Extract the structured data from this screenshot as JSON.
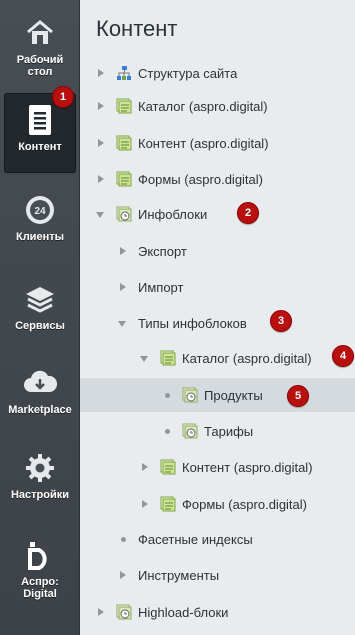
{
  "sidebar": {
    "items": [
      {
        "label": "Рабочий стол",
        "icon": "home-icon"
      },
      {
        "label": "Контент",
        "icon": "document-icon",
        "active": true
      },
      {
        "label": "Клиенты",
        "icon": "clock-24-icon"
      },
      {
        "label": "Сервисы",
        "icon": "layers-icon"
      },
      {
        "label": "Marketplace",
        "icon": "cloud-download-icon"
      },
      {
        "label": "Настройки",
        "icon": "gear-icon"
      },
      {
        "label": "Аспро: Digital",
        "icon": "aspro-logo-icon"
      }
    ]
  },
  "panel": {
    "title": "Контент",
    "tree": [
      {
        "label": "Структура сайта",
        "icon": "site-structure-icon",
        "expander": "right"
      },
      {
        "label": "Каталог (aspro.digital)",
        "icon": "module-icon",
        "expander": "right"
      },
      {
        "label": "Контент (aspro.digital)",
        "icon": "module-icon",
        "expander": "right"
      },
      {
        "label": "Формы (aspro.digital)",
        "icon": "module-icon",
        "expander": "right"
      },
      {
        "label": "Инфоблоки",
        "icon": "iblock-icon",
        "expander": "down"
      },
      {
        "label": "Экспорт",
        "icon": "",
        "expander": "right"
      },
      {
        "label": "Импорт",
        "icon": "",
        "expander": "right"
      },
      {
        "label": "Типы инфоблоков",
        "icon": "",
        "expander": "down"
      },
      {
        "label": "Каталог (aspro.digital)",
        "icon": "module-icon",
        "expander": "down"
      },
      {
        "label": "Продукты",
        "icon": "iblock-icon",
        "expander": "dot",
        "selected": true
      },
      {
        "label": "Тарифы",
        "icon": "iblock-icon",
        "expander": "dot"
      },
      {
        "label": "Контент (aspro.digital)",
        "icon": "module-icon",
        "expander": "right"
      },
      {
        "label": "Формы (aspro.digital)",
        "icon": "module-icon",
        "expander": "right"
      },
      {
        "label": "Фасетные индексы",
        "icon": "",
        "expander": "dot"
      },
      {
        "label": "Инструменты",
        "icon": "",
        "expander": "right"
      },
      {
        "label": "Highload-блоки",
        "icon": "iblock-icon",
        "expander": "right"
      }
    ]
  },
  "badges": [
    "1",
    "2",
    "3",
    "4",
    "5"
  ],
  "colors": {
    "sidebar_bg": "#474e54",
    "active_bg": "#23282c",
    "badge": "#b80f0f",
    "panel_bg": "#e9ecee",
    "selected_row": "#d4dade",
    "module_icon_green": "#8bbf3f"
  }
}
